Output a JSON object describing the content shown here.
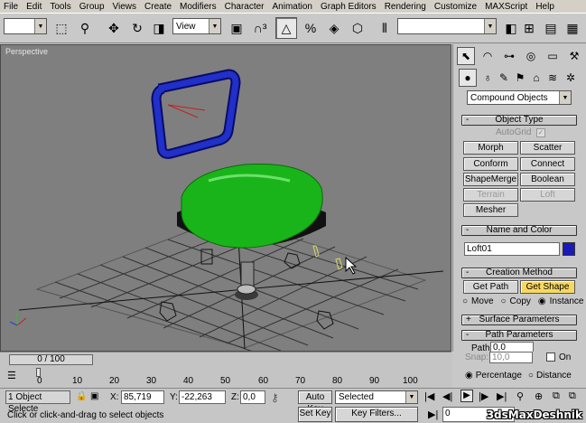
{
  "menu": [
    "File",
    "Edit",
    "Tools",
    "Group",
    "Views",
    "Create",
    "Modifiers",
    "Character",
    "Animation",
    "Graph Editors",
    "Rendering",
    "Customize",
    "MAXScript",
    "Help"
  ],
  "toolbar": {
    "selection_set": "",
    "coord_dropdown": "View",
    "named_sel": ""
  },
  "viewport": {
    "label": "Perspective"
  },
  "cmdpanel": {
    "category_dropdown": "Compound Objects",
    "object_type": {
      "title": "Object Type",
      "autogrid": "AutoGrid",
      "buttons": [
        "Morph",
        "Scatter",
        "Conform",
        "Connect",
        "ShapeMerge",
        "Boolean",
        "Terrain",
        "Loft",
        "Mesher"
      ]
    },
    "name_color": {
      "title": "Name and Color",
      "name": "Loft01",
      "color": "#1a1ab4"
    },
    "creation_method": {
      "title": "Creation Method",
      "get_path": "Get Path",
      "get_shape": "Get Shape",
      "move": "Move",
      "copy": "Copy",
      "instance": "Instance"
    },
    "surface_params": {
      "title": "Surface Parameters"
    },
    "path_params": {
      "title": "Path Parameters",
      "path_label": "Path:",
      "path_value": "0,0",
      "snap_label": "Snap:",
      "snap_value": "10,0",
      "on_label": "On",
      "percentage": "Percentage",
      "distance": "Distance"
    }
  },
  "timeslider": {
    "frame": "0 / 100"
  },
  "track": {
    "ticks": [
      "0",
      "10",
      "20",
      "30",
      "40",
      "50",
      "60",
      "70",
      "80",
      "90",
      "100"
    ]
  },
  "status": {
    "selected": "1 Object Selecte",
    "x_label": "X:",
    "x_value": "85,719",
    "y_label": "Y:",
    "y_value": "-22,263",
    "z_label": "Z:",
    "z_value": "0,0",
    "prompt": "Click or click-and-drag to select objects",
    "auto_key": "Auto Key",
    "set_key": "Set Key",
    "key_dropdown": "Selected",
    "key_filters": "Key Filters...",
    "frame_field": "0",
    "watermark": "3dsMaxDeshnik"
  },
  "colors": {
    "seat": "#1fa01f",
    "frame": "#1a1ab4",
    "highlight": "#f7d760"
  }
}
